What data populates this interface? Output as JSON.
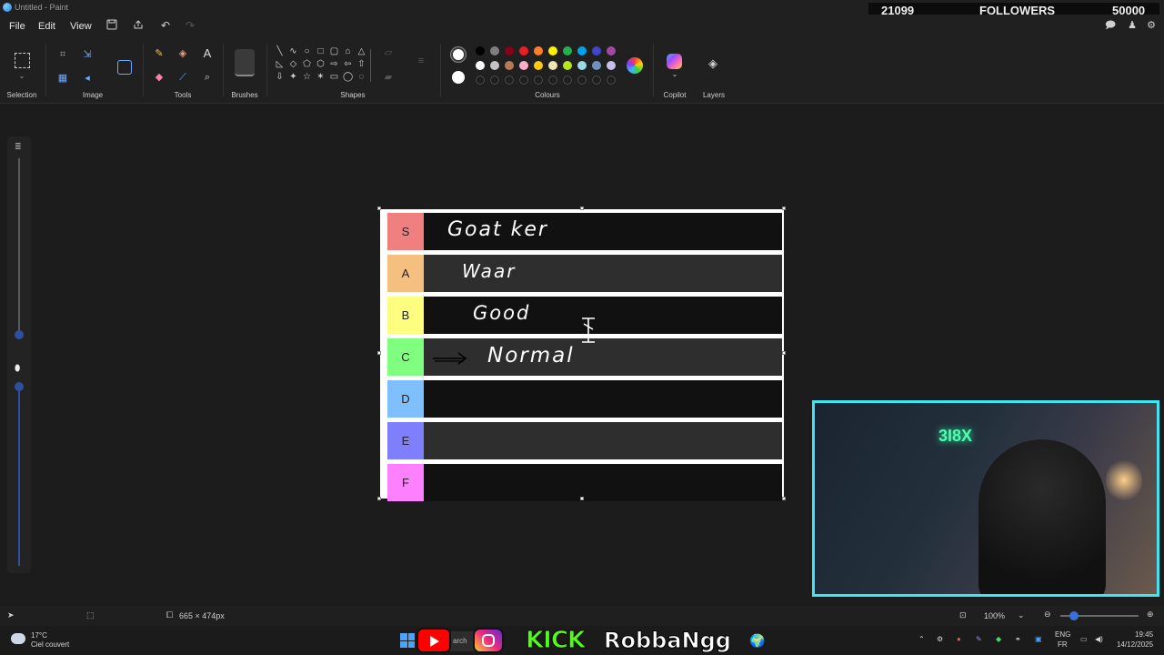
{
  "window": {
    "title": "Untitled - Paint"
  },
  "overlay": {
    "followers_current": "21099",
    "followers_label": "FOLLOWERS",
    "followers_goal": "50000"
  },
  "menu": {
    "file": "File",
    "edit": "Edit",
    "view": "View"
  },
  "ribbon": {
    "groups": {
      "selection": "Selection",
      "image": "Image",
      "tools": "Tools",
      "brushes": "Brushes",
      "shapes": "Shapes",
      "colours": "Colours",
      "copilot": "Copilot",
      "layers": "Layers"
    },
    "colors": {
      "primary": "#ffffff",
      "secondary": "#ffffff",
      "palette_row1": [
        "#000000",
        "#7f7f7f",
        "#880015",
        "#ed1c24",
        "#ff7f27",
        "#fff200",
        "#22b14c",
        "#00a2e8",
        "#3f48cc",
        "#a349a4"
      ],
      "palette_row2": [
        "#ffffff",
        "#c3c3c3",
        "#b97a57",
        "#ffaec9",
        "#ffc90e",
        "#efe4b0",
        "#b5e61d",
        "#99d9ea",
        "#7092be",
        "#c8bfe7"
      ]
    }
  },
  "tierlist": {
    "rows": [
      {
        "label": "S",
        "color": "#f07f7f",
        "band": "#111111",
        "text": "Goat ker"
      },
      {
        "label": "A",
        "color": "#f5bf80",
        "band": "#2e2e2e",
        "text": "Waar"
      },
      {
        "label": "B",
        "color": "#fdfd7f",
        "band": "#111111",
        "text": "Good"
      },
      {
        "label": "C",
        "color": "#80fe7f",
        "band": "#2e2e2e",
        "text": "Normal"
      },
      {
        "label": "D",
        "color": "#7fbffe",
        "band": "#111111",
        "text": ""
      },
      {
        "label": "E",
        "color": "#7f7ffe",
        "band": "#2e2e2e",
        "text": ""
      },
      {
        "label": "F",
        "color": "#fd80fe",
        "band": "#111111",
        "text": ""
      }
    ]
  },
  "status": {
    "canvas_size": "665 × 474px",
    "zoom": "100%"
  },
  "taskbar": {
    "weather_temp": "17°C",
    "weather_desc": "Ciel couvert",
    "search_fragment": "arch",
    "streamer_name": "RobbaNgg",
    "kick_label": "KICK",
    "lang_top": "ENG",
    "lang_bottom": "FR",
    "time": "19:45",
    "date": "14/12/2025"
  },
  "webcam": {
    "neon_sign": "3I8X"
  }
}
